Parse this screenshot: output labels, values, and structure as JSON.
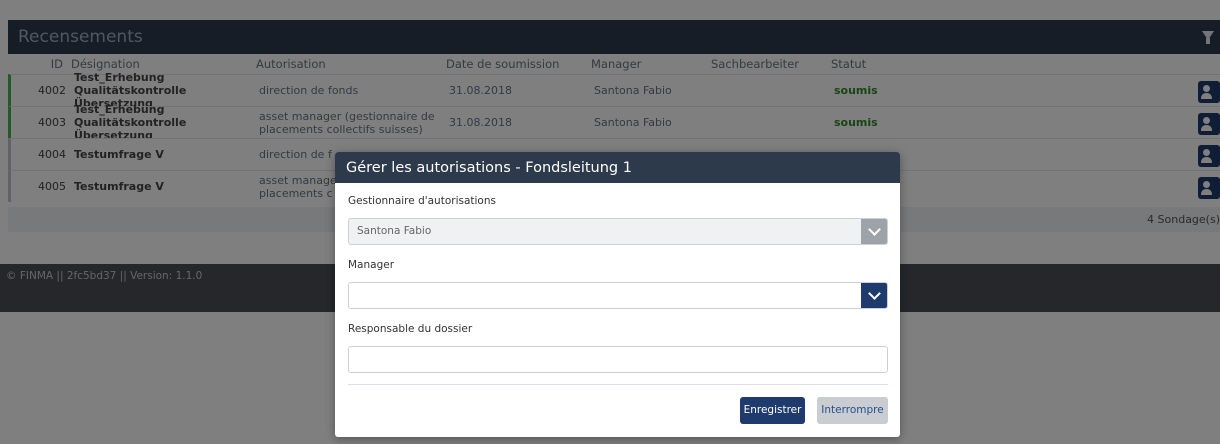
{
  "panel": {
    "title": "Recensements",
    "columns": {
      "id": "ID",
      "designation": "Désignation",
      "autorisation": "Autorisation",
      "date": "Date de soumission",
      "manager": "Manager",
      "sachbearbeiter": "Sachbearbeiter",
      "statut": "Statut"
    },
    "rows": [
      {
        "id": "4002",
        "designation_l1": "Test_Erhebung Qualitätskontrolle",
        "designation_l2": "Übersetzung",
        "autorisation_l1": "direction de fonds",
        "autorisation_l2": "",
        "date": "31.08.2018",
        "manager": "Santona Fabio",
        "sachbearbeiter": "",
        "statut": "soumis"
      },
      {
        "id": "4003",
        "designation_l1": "Test_Erhebung Qualitätskontrolle",
        "designation_l2": "Übersetzung",
        "autorisation_l1": "asset manager (gestionnaire de",
        "autorisation_l2": "placements collectifs suisses)",
        "date": "31.08.2018",
        "manager": "Santona Fabio",
        "sachbearbeiter": "",
        "statut": "soumis"
      },
      {
        "id": "4004",
        "designation_l1": "Testumfrage V",
        "designation_l2": "",
        "autorisation_l1": "direction de f",
        "autorisation_l2": "",
        "date": "",
        "manager": "",
        "sachbearbeiter": "",
        "statut": ""
      },
      {
        "id": "4005",
        "designation_l1": "Testumfrage V",
        "designation_l2": "",
        "autorisation_l1": "asset manage",
        "autorisation_l2": "placements c",
        "date": "",
        "manager": "",
        "sachbearbeiter": "",
        "statut": ""
      }
    ],
    "footer_count": "4 Sondage(s)"
  },
  "footer": {
    "text": "© FINMA || 2fc5bd37 || Version: 1.1.0"
  },
  "modal": {
    "title": "Gérer les autorisations - Fondsleitung 1",
    "field1_label": "Gestionnaire d'autorisations",
    "field1_value": "Santona Fabio",
    "field2_label": "Manager",
    "field2_value": "",
    "field3_label": "Responsable du dossier",
    "field3_value": "",
    "save_label": "Enregistrer",
    "cancel_label": "Interrompre"
  },
  "colors": {
    "header_bg": "#2d3a4c",
    "primary_button": "#1f3b6e",
    "status_green": "#2e8b2e"
  }
}
